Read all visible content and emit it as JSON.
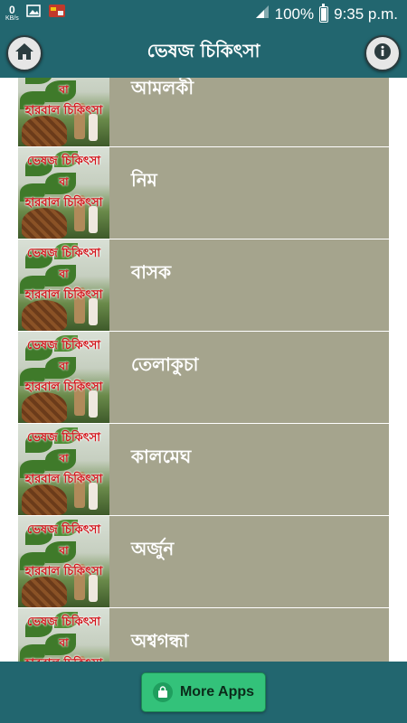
{
  "status_bar": {
    "data_speed_value": "0",
    "data_speed_unit": "KB/s",
    "battery": "100%",
    "time": "9:35 p.m.",
    "icons": [
      "image-icon",
      "media-app-icon",
      "signal-icon",
      "battery-icon"
    ]
  },
  "app_bar": {
    "title": "ভেষজ চিকিৎসা",
    "home_icon": "home-icon",
    "info_icon": "info-icon"
  },
  "thumbnail_text": {
    "line1": "ভেষজ চিকিৎসা",
    "line2": "বা",
    "line3": "হারবাল চিকিৎসা"
  },
  "items": [
    {
      "label": "আমলকী"
    },
    {
      "label": "নিম"
    },
    {
      "label": "বাসক"
    },
    {
      "label": "তেলাকুচা"
    },
    {
      "label": "কালমেঘ"
    },
    {
      "label": "অর্জুন"
    },
    {
      "label": "অশ্বগন্ধা"
    }
  ],
  "bottom_bar": {
    "more_apps_label": "More Apps",
    "more_apps_icon": "shopping-bag-icon"
  },
  "colors": {
    "primary": "#22666f",
    "row_background": "#a5a48d",
    "button_green": "#33c27a",
    "thumb_text_red": "#d3141b"
  }
}
